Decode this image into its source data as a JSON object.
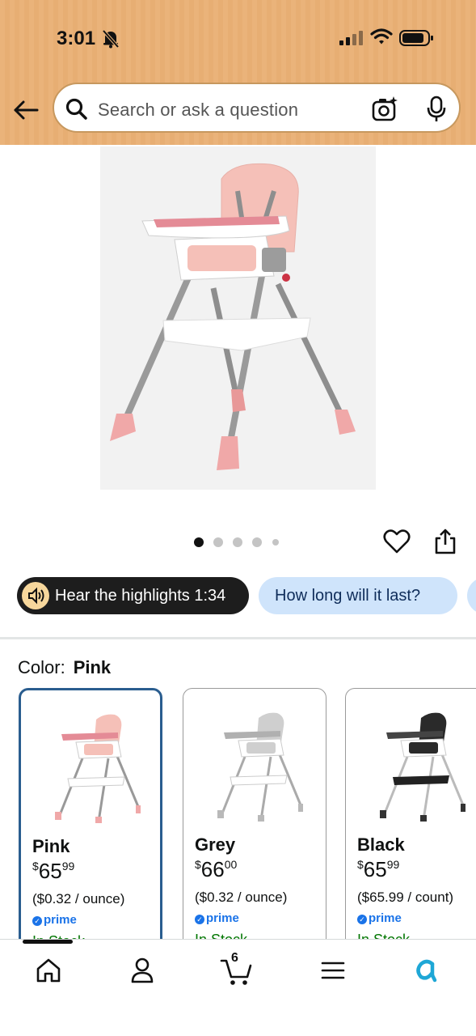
{
  "status_bar": {
    "time": "3:01",
    "icons": [
      "bell-slash-icon",
      "signal-icon",
      "wifi-icon",
      "battery-icon"
    ]
  },
  "header": {
    "back_icon": "arrow-left-icon",
    "search": {
      "placeholder": "Search or ask a question",
      "icons": [
        "search-icon",
        "camera-icon",
        "microphone-icon"
      ]
    }
  },
  "product": {
    "image_alt_icon": "high-chair-image",
    "carousel": {
      "count": 5,
      "active_index": 0
    },
    "actions": [
      "heart-icon",
      "share-icon"
    ]
  },
  "chips": {
    "audio_label": "Hear the highlights 1:34",
    "question_label": "How long will it last?"
  },
  "variant": {
    "color_label": "Color:",
    "color_value": "Pink",
    "options": [
      {
        "name": "Pink",
        "price_symbol": "$",
        "price_whole": "65",
        "price_fraction": "99",
        "unit_price": "($0.32 / ounce)",
        "prime": "prime",
        "stock": "In Stock",
        "selected": true
      },
      {
        "name": "Grey",
        "price_symbol": "$",
        "price_whole": "66",
        "price_fraction": "00",
        "unit_price": "($0.32 / ounce)",
        "prime": "prime",
        "stock": "In Stock",
        "selected": false
      },
      {
        "name": "Black",
        "price_symbol": "$",
        "price_whole": "65",
        "price_fraction": "99",
        "unit_price": "($65.99 / count)",
        "prime": "prime",
        "stock": "In Stock",
        "selected": false
      }
    ]
  },
  "bottom_nav": {
    "items": [
      "home-icon",
      "account-icon",
      "cart-icon",
      "menu-icon",
      "rufus-icon"
    ],
    "cart_count": "6"
  },
  "colors": {
    "header_bg": "#eab37a",
    "chip_dark": "#1d1d1d",
    "chip_light": "#cfe4fb",
    "selected_border": "#2a5d8f",
    "prime_blue": "#1a73e8",
    "stock_green": "#007600",
    "chair_pink": "#f0a8a8"
  }
}
